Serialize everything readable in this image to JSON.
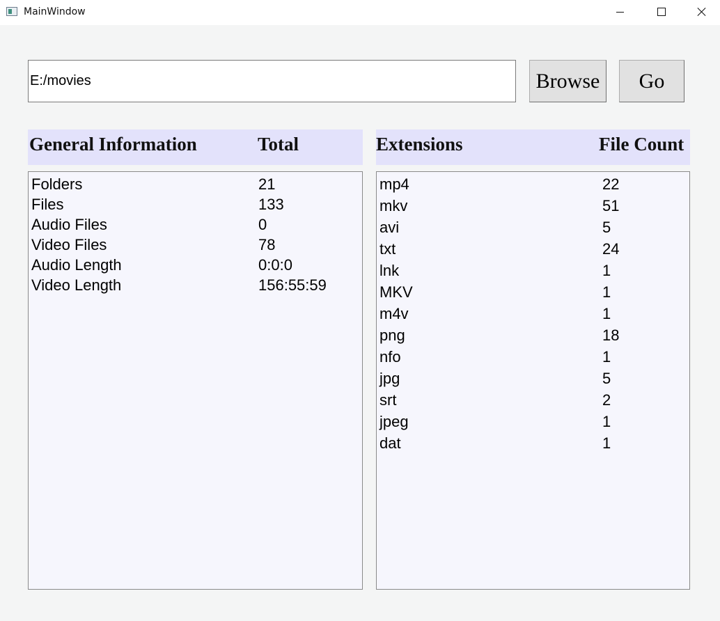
{
  "window": {
    "title": "MainWindow"
  },
  "toolbar": {
    "path_value": "E:/movies",
    "browse_label": "Browse",
    "go_label": "Go"
  },
  "general": {
    "header_label": "General Information",
    "header_value": "Total",
    "rows": [
      {
        "label": "Folders",
        "value": "21"
      },
      {
        "label": "Files",
        "value": "133"
      },
      {
        "label": "Audio Files",
        "value": "0"
      },
      {
        "label": "Video Files",
        "value": "78"
      },
      {
        "label": "Audio Length",
        "value": "0:0:0"
      },
      {
        "label": "Video Length",
        "value": "156:55:59"
      }
    ]
  },
  "extensions": {
    "header_label": "Extensions",
    "header_value": "File Count",
    "rows": [
      {
        "ext": "mp4",
        "count": "22"
      },
      {
        "ext": "mkv",
        "count": "51"
      },
      {
        "ext": "avi",
        "count": "5"
      },
      {
        "ext": "txt",
        "count": "24"
      },
      {
        "ext": "lnk",
        "count": "1"
      },
      {
        "ext": "MKV",
        "count": "1"
      },
      {
        "ext": "m4v",
        "count": "1"
      },
      {
        "ext": "png",
        "count": "18"
      },
      {
        "ext": "nfo",
        "count": "1"
      },
      {
        "ext": "jpg",
        "count": "5"
      },
      {
        "ext": "srt",
        "count": "2"
      },
      {
        "ext": "jpeg",
        "count": "1"
      },
      {
        "ext": "dat",
        "count": "1"
      }
    ]
  },
  "colors": {
    "header_bg": "#e3e2fb",
    "list_bg": "#f6f6fd",
    "window_bg": "#f4f5f5"
  }
}
